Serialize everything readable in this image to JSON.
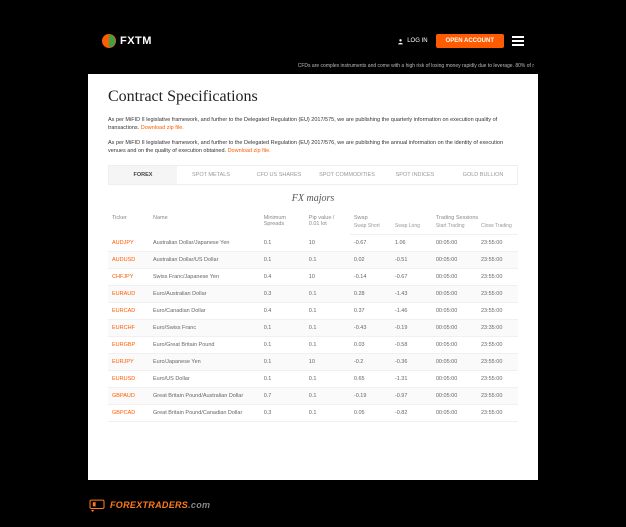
{
  "header": {
    "brand": "FXTM",
    "login_label": "LOG IN",
    "open_account_label": "OPEN ACCOUNT",
    "risk_warning": "CFDs are complex instruments and come with a high risk of losing money rapidly due to leverage. 80% of r"
  },
  "page_title": "Contract Specifications",
  "desc1_prefix": "As per MiFID II legislative framework, and further to the Delegated Regulation (EU) 2017/575, we are publishing the quarterly information on execution quality of transactions. ",
  "desc1_link": "Download zip file.",
  "desc2_prefix": "As per MiFID II legislative framework, and further to the Delegated Regulation (EU) 2017/576, we are publishing the annual information on the identity of execution venues and on the quality of execution obtained. ",
  "desc2_link": "Download zip file.",
  "tabs": [
    "FOREX",
    "SPOT METALS",
    "CFD US SHARES",
    "SPOT COMMODITIES",
    "SPOT INDICES",
    "GOLD BULLION"
  ],
  "tab_content_title": "FX majors",
  "columns": {
    "ticker": "Ticker",
    "name": "Name",
    "min_spreads": "Minimum Spreads",
    "pip_value": "Pip value / 0.01 lot",
    "swap": "Swap",
    "swap_short": "Swap Short",
    "swap_long": "Swap Long",
    "trading_sessions": "Trading Sessions",
    "start_trading": "Start Trading",
    "close_trading": "Close Trading"
  },
  "rows": [
    {
      "ticker": "AUDJPY",
      "name": "Australian Dollar/Japanese Yen",
      "spread": "0.1",
      "pip": "10",
      "ss": "-0.67",
      "sl": "1.06",
      "st": "00:05:00",
      "ct": "23:55:00"
    },
    {
      "ticker": "AUDUSD",
      "name": "Australian Dollar/US Dollar",
      "spread": "0.1",
      "pip": "0.1",
      "ss": "0.02",
      "sl": "-0.51",
      "st": "00:05:00",
      "ct": "23:55:00"
    },
    {
      "ticker": "CHFJPY",
      "name": "Swiss Franc/Japanese Yen",
      "spread": "0.4",
      "pip": "10",
      "ss": "-0.14",
      "sl": "-0.67",
      "st": "00:05:00",
      "ct": "23:55:00"
    },
    {
      "ticker": "EURAUD",
      "name": "Euro/Australian Dollar",
      "spread": "0.3",
      "pip": "0.1",
      "ss": "0.28",
      "sl": "-1.43",
      "st": "00:05:00",
      "ct": "23:55:00"
    },
    {
      "ticker": "EURCAD",
      "name": "Euro/Canadian Dollar",
      "spread": "0.4",
      "pip": "0.1",
      "ss": "0.37",
      "sl": "-1.46",
      "st": "00:05:00",
      "ct": "23:55:00"
    },
    {
      "ticker": "EURCHF",
      "name": "Euro/Swiss Franc",
      "spread": "0.1",
      "pip": "0.1",
      "ss": "-0.43",
      "sl": "-0.19",
      "st": "00:05:00",
      "ct": "23:35:00"
    },
    {
      "ticker": "EURGBP",
      "name": "Euro/Great Britain Pound",
      "spread": "0.1",
      "pip": "0.1",
      "ss": "0.03",
      "sl": "-0.58",
      "st": "00:05:00",
      "ct": "23:55:00"
    },
    {
      "ticker": "EURJPY",
      "name": "Euro/Japanese Yen",
      "spread": "0.1",
      "pip": "10",
      "ss": "-0.2",
      "sl": "-0.36",
      "st": "00:05:00",
      "ct": "23:55:00"
    },
    {
      "ticker": "EURUSD",
      "name": "Euro/US Dollar",
      "spread": "0.1",
      "pip": "0.1",
      "ss": "0.65",
      "sl": "-1.31",
      "st": "00:05:00",
      "ct": "23:55:00"
    },
    {
      "ticker": "GBPAUD",
      "name": "Great Britain Pound/Australian Dollar",
      "spread": "0.7",
      "pip": "0.1",
      "ss": "-0.19",
      "sl": "-0.97",
      "st": "00:05:00",
      "ct": "23:55:00"
    },
    {
      "ticker": "GBPCAD",
      "name": "Great Britain Pound/Canadian Dollar",
      "spread": "0.3",
      "pip": "0.1",
      "ss": "0.05",
      "sl": "-0.82",
      "st": "00:05:00",
      "ct": "23:55:00"
    }
  ],
  "footer_brand_main": "FOREXTRADERS",
  "footer_brand_suffix": ".com"
}
